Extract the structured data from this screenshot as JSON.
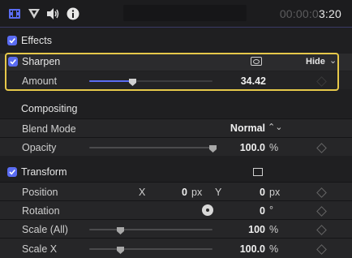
{
  "toolbar": {
    "icons": [
      "film-icon",
      "filter-icon",
      "audio-icon",
      "info-icon"
    ],
    "timecode_dim": "00:00:0",
    "timecode_bright": "3:20"
  },
  "effects": {
    "label": "Effects",
    "checked": true
  },
  "sharpen": {
    "label": "Sharpen",
    "checked": true,
    "hide_label": "Hide",
    "amount": {
      "label": "Amount",
      "value": "34.42",
      "level": 0.35
    }
  },
  "compositing": {
    "label": "Compositing",
    "blend_mode": {
      "label": "Blend Mode",
      "value": "Normal"
    },
    "opacity": {
      "label": "Opacity",
      "value": "100.0",
      "unit": "%",
      "level": 1.0
    }
  },
  "transform": {
    "label": "Transform",
    "checked": true,
    "position": {
      "label": "Position",
      "x_label": "X",
      "x_value": "0",
      "x_unit": "px",
      "y_label": "Y",
      "y_value": "0",
      "y_unit": "px"
    },
    "rotation": {
      "label": "Rotation",
      "value": "0",
      "unit": "°"
    },
    "scale_all": {
      "label": "Scale (All)",
      "value": "100",
      "unit": "%",
      "level": 0.25
    },
    "scale_x": {
      "label": "Scale X",
      "value": "100.0",
      "unit": "%",
      "level": 0.25
    }
  },
  "colors": {
    "accent": "#5a6cf2",
    "highlight": "#e6c84a"
  }
}
